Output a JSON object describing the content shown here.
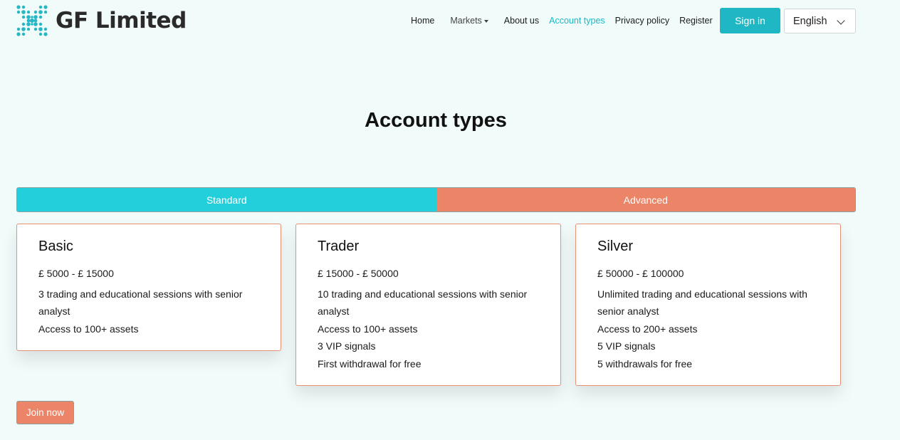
{
  "brand": {
    "name": "GF Limited",
    "logo_icon": "x-dots-logo-icon"
  },
  "nav": {
    "home": "Home",
    "markets": "Markets",
    "about": "About us",
    "account_types": "Account types",
    "privacy": "Privacy policy",
    "register": "Register"
  },
  "auth": {
    "signin": "Sign in"
  },
  "language": {
    "selected": "English"
  },
  "page": {
    "title": "Account types"
  },
  "tabs": {
    "standard": "Standard",
    "advanced": "Advanced"
  },
  "cards": [
    {
      "name": "Basic",
      "price": "£ 5000 - £ 15000",
      "features": [
        "3 trading and educational sessions with senior analyst",
        "Access to 100+ assets"
      ]
    },
    {
      "name": "Trader",
      "price": "£ 15000 - £ 50000",
      "features": [
        "10 trading and educational sessions with senior analyst",
        "Access to 100+ assets",
        "3 VIP signals",
        "First withdrawal for free"
      ]
    },
    {
      "name": "Silver",
      "price": "£ 50000 - £ 100000",
      "features": [
        "Unlimited trading and educational sessions with senior analyst",
        "Access to 200+ assets",
        "5 VIP signals",
        "5 withdrawals for free"
      ]
    }
  ],
  "cta": {
    "join": "Join now"
  },
  "colors": {
    "accent": "#1fb7c4",
    "tab_standard": "#22cfdb",
    "tab_advanced": "#ec8467",
    "background": "#f1fbfa"
  }
}
